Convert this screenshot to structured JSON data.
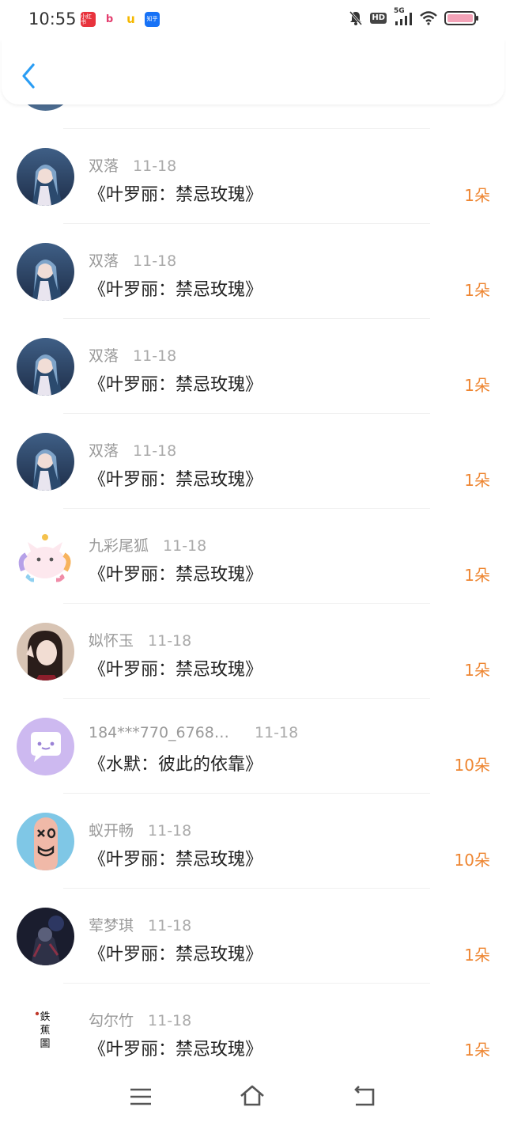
{
  "status_bar": {
    "time": "10:55",
    "app_icons": [
      {
        "icon": "red-app-icon",
        "label": "小红书"
      },
      {
        "icon": "bilibili-icon",
        "label": "b"
      },
      {
        "icon": "yellow-app-icon",
        "label": "u"
      },
      {
        "icon": "zhihu-icon",
        "label": "知乎"
      }
    ],
    "hd_label": "HD",
    "network_label": "5G",
    "battery_color": "#f3a2b7"
  },
  "header": {
    "back_icon": "chevron-left-icon",
    "accent": "#2a9df4"
  },
  "gifts": [
    {
      "nick": "双落",
      "time": "11-18",
      "title": "《叶罗丽：禁忌玫瑰》",
      "amount": "1朵",
      "avatar": "anime-girl-avatar"
    },
    {
      "nick": "双落",
      "time": "11-18",
      "title": "《叶罗丽：禁忌玫瑰》",
      "amount": "1朵",
      "avatar": "anime-girl-avatar"
    },
    {
      "nick": "双落",
      "time": "11-18",
      "title": "《叶罗丽：禁忌玫瑰》",
      "amount": "1朵",
      "avatar": "anime-girl-avatar"
    },
    {
      "nick": "双落",
      "time": "11-18",
      "title": "《叶罗丽：禁忌玫瑰》",
      "amount": "1朵",
      "avatar": "anime-girl-avatar"
    },
    {
      "nick": "九彩尾狐",
      "time": "11-18",
      "title": "《叶罗丽：禁忌玫瑰》",
      "amount": "1朵",
      "avatar": "fox-avatar"
    },
    {
      "nick": "姒怀玉",
      "time": "11-18",
      "title": "《叶罗丽：禁忌玫瑰》",
      "amount": "1朵",
      "avatar": "girl-photo-avatar"
    },
    {
      "nick": "184***770_6768…",
      "time": "11-18",
      "title": "《水默：彼此的依靠》",
      "amount": "10朵",
      "avatar": "chat-bubble-avatar"
    },
    {
      "nick": "蚁开畅",
      "time": "11-18",
      "title": "《叶罗丽：禁忌玫瑰》",
      "amount": "10朵",
      "avatar": "finger-face-avatar"
    },
    {
      "nick": "荤梦琪",
      "time": "11-18",
      "title": "《叶罗丽：禁忌玫瑰》",
      "amount": "1朵",
      "avatar": "dark-character-avatar"
    },
    {
      "nick": "勾尔竹",
      "time": "11-18",
      "title": "《叶罗丽：禁忌玫瑰》",
      "amount": "1朵",
      "avatar": "calligraphy-avatar"
    }
  ],
  "calligraphy_text": "鉄 蕉 圖",
  "amount_color": "#ee8632",
  "nav": {
    "menu_icon": "menu-icon",
    "home_icon": "home-icon",
    "back_icon": "back-icon"
  }
}
